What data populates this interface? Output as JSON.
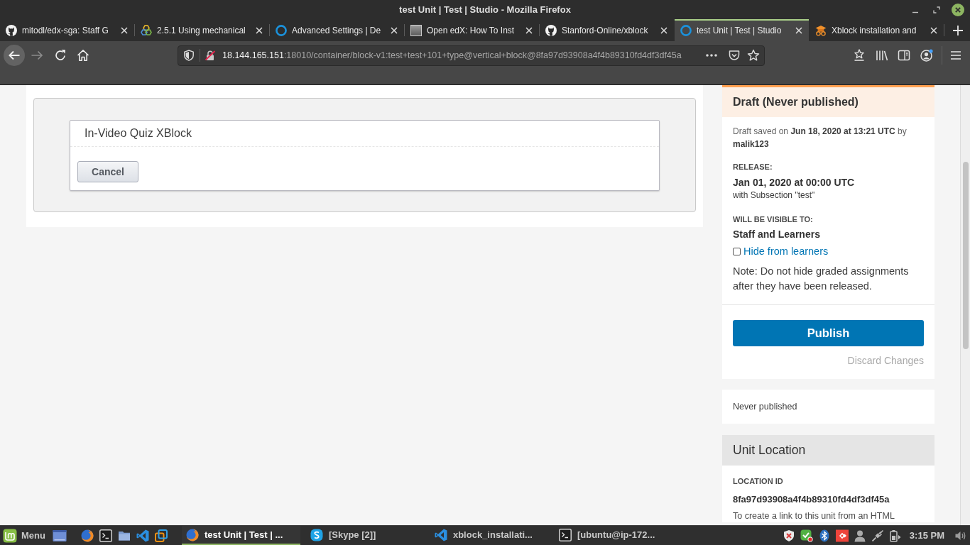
{
  "window": {
    "title": "test Unit | Test | Studio - Mozilla Firefox"
  },
  "tabs": [
    {
      "label": "mitodl/edx-sga: Staff G",
      "kind": "cat",
      "selected": false
    },
    {
      "label": "2.5.1 Using mechanical",
      "kind": "hexagons",
      "selected": false
    },
    {
      "label": "Advanced Settings | De",
      "kind": "ring",
      "selected": false
    },
    {
      "label": "Open edX: How To Inst",
      "kind": "photo",
      "selected": false
    },
    {
      "label": "Stanford-Online/xblock",
      "kind": "cat",
      "selected": false
    },
    {
      "label": "test Unit | Test | Studio",
      "kind": "ring",
      "selected": true
    },
    {
      "label": "Xblock installation and",
      "kind": "cap",
      "selected": false
    }
  ],
  "address_bar": {
    "host": "18.144.165.151",
    "path": ":18010/container/block-v1:test+test+101+type@vertical+block@8fa97d93908a4f4b89310fd4df3df45a"
  },
  "editor": {
    "title": "In-Video Quiz XBlock",
    "cancel_button": "Cancel"
  },
  "publish_panel": {
    "heading": "Draft (Never published)",
    "saved_note": "Draft saved on **Jun 18, 2020 at 13:21 UTC** by **malik123**",
    "release_label": "RELEASE:",
    "release_date": "Jan 01, 2020 at 00:00 UTC",
    "release_scope": "with Subsection \"test\"",
    "visibility_label": "WILL BE VISIBLE TO:",
    "visibility": "Staff and Learners",
    "hide_option": {
      "label": "Hide from learners",
      "checked": false
    },
    "note": "Note: Do not hide graded assignments after they have been released.",
    "publish_button": "Publish",
    "discard_link": "Discard Changes"
  },
  "publish_history": {
    "text": "Never published"
  },
  "unit_location": {
    "heading": "Unit Location",
    "id_label": "LOCATION ID",
    "id": "8fa97d93908a4f4b89310fd4df3df45a",
    "help": "To create a link to this unit from an HTML"
  },
  "taskbar": {
    "menu": "Menu",
    "windows": [
      {
        "label": "test Unit | Test | ...",
        "kind": "browser",
        "selected": true
      },
      {
        "label": "[Skype [2]]",
        "kind": "chat",
        "selected": false
      },
      {
        "label": "xblock_installati...",
        "kind": "editor",
        "selected": false
      },
      {
        "label": "[ubuntu@ip-172...",
        "kind": "terminal",
        "selected": false
      }
    ],
    "clock": "3:15 PM"
  }
}
